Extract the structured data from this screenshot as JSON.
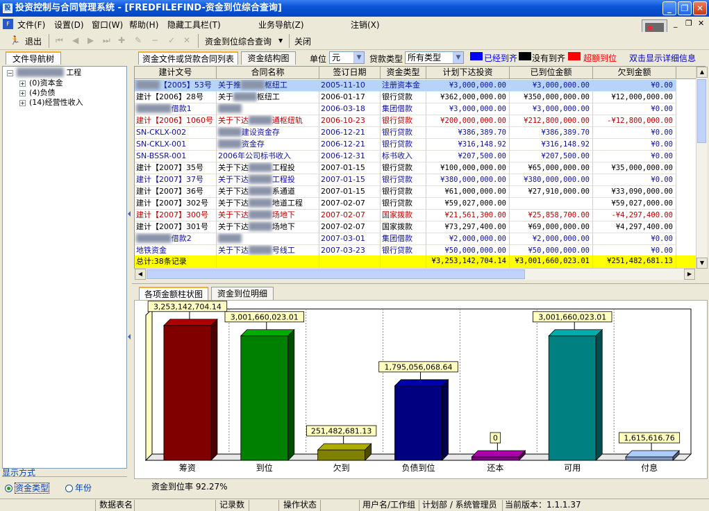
{
  "window": {
    "title": "投资控制与合同管理系统 - [FREDFILEFIND-资金到位综合查询]"
  },
  "menu": [
    "文件(F)",
    "设置(D)",
    "窗口(W)",
    "帮助(H)",
    "隐藏工具栏(T)",
    "业务导航(Z)",
    "注销(X)"
  ],
  "toolbar": {
    "exit_label": "退出",
    "dropdown_label": "资金到位综合查询",
    "close_label": "关闭"
  },
  "left_panel": {
    "tab": "文件导航树",
    "tree": [
      "工程",
      "(0)资本金",
      "(4)负债",
      "(14)经营性收入"
    ],
    "display_mode_label": "显示方式",
    "options": [
      "资金类型",
      "年份"
    ],
    "selected": "资金类型"
  },
  "filter": {
    "tabs": [
      "资金文件或贷款合同列表",
      "资金结构图"
    ],
    "unit_label": "单位",
    "unit_value": "元",
    "loan_type_label": "贷款类型",
    "loan_type_value": "所有类型",
    "legend": [
      {
        "label": "已经到齐",
        "color": "#0000ff"
      },
      {
        "label": "没有到齐",
        "color": "#000000"
      },
      {
        "label": "超额到位",
        "color": "#ff0000"
      }
    ],
    "hint": "双击显示详细信息"
  },
  "table": {
    "columns": [
      "建计文号",
      "合同名称",
      "签订日期",
      "资金类型",
      "计划下达投资",
      "已到位金额",
      "欠到金额"
    ],
    "rows": [
      {
        "doc": "【2005】53号",
        "name": "关于推",
        "name2": "枢纽工",
        "date": "2005-11-10",
        "type": "注册资本金",
        "plan": "¥3,000,000.00",
        "arrived": "¥3,000,000.00",
        "owed": "¥0.00",
        "color": "blue"
      },
      {
        "doc": "建计【2006】28号",
        "name": "关于",
        "name2": "枢纽工",
        "date": "2006-01-17",
        "type": "银行贷款",
        "plan": "¥362,000,000.00",
        "arrived": "¥350,000,000.00",
        "owed": "¥12,000,000.00",
        "color": "black"
      },
      {
        "doc": "借款1",
        "name": "",
        "name2": "",
        "date": "2006-03-18",
        "type": "集团借款",
        "plan": "¥3,000,000.00",
        "arrived": "¥3,000,000.00",
        "owed": "¥0.00",
        "color": "blue"
      },
      {
        "doc": "建计【2006】1060号",
        "name": "关于下达",
        "name2": "通枢纽轨",
        "date": "2006-10-23",
        "type": "银行贷款",
        "plan": "¥200,000,000.00",
        "arrived": "¥212,800,000.00",
        "owed": "-¥12,800,000.00",
        "color": "red"
      },
      {
        "doc": "SN-CKLX-002",
        "name": "",
        "name2": "建设资金存",
        "date": "2006-12-21",
        "type": "银行贷款",
        "plan": "¥386,389.70",
        "arrived": "¥386,389.70",
        "owed": "¥0.00",
        "color": "blue"
      },
      {
        "doc": "SN-CKLX-001",
        "name": "",
        "name2": "资金存",
        "date": "2006-12-21",
        "type": "银行贷款",
        "plan": "¥316,148.92",
        "arrived": "¥316,148.92",
        "owed": "¥0.00",
        "color": "blue"
      },
      {
        "doc": "SN-BSSR-001",
        "name": "2006年公司标书收入",
        "name2": "",
        "date": "2006-12-31",
        "type": "标书收入",
        "plan": "¥207,500.00",
        "arrived": "¥207,500.00",
        "owed": "¥0.00",
        "color": "blue"
      },
      {
        "doc": "建计【2007】35号",
        "name": "关于下达",
        "name2": "工程投",
        "date": "2007-01-15",
        "type": "银行贷款",
        "plan": "¥100,000,000.00",
        "arrived": "¥65,000,000.00",
        "owed": "¥35,000,000.00",
        "color": "black"
      },
      {
        "doc": "建计【2007】37号",
        "name": "关于下达",
        "name2": "工程投",
        "date": "2007-01-15",
        "type": "银行贷款",
        "plan": "¥380,000,000.00",
        "arrived": "¥380,000,000.00",
        "owed": "¥0.00",
        "color": "blue"
      },
      {
        "doc": "建计【2007】36号",
        "name": "关于下达",
        "name2": "系通道",
        "date": "2007-01-15",
        "type": "银行贷款",
        "plan": "¥61,000,000.00",
        "arrived": "¥27,910,000.00",
        "owed": "¥33,090,000.00",
        "color": "black"
      },
      {
        "doc": "建计【2007】302号",
        "name": "关于下达",
        "name2": "地道工程",
        "date": "2007-02-07",
        "type": "银行贷款",
        "plan": "¥59,027,000.00",
        "arrived": "",
        "owed": "¥59,027,000.00",
        "color": "black"
      },
      {
        "doc": "建计【2007】300号",
        "name": "关于下达",
        "name2": "场地下",
        "date": "2007-02-07",
        "type": "国家拨款",
        "plan": "¥21,561,300.00",
        "arrived": "¥25,858,700.00",
        "owed": "-¥4,297,400.00",
        "color": "red"
      },
      {
        "doc": "建计【2007】301号",
        "name": "关于下达",
        "name2": "场地下",
        "date": "2007-02-07",
        "type": "国家拨款",
        "plan": "¥73,297,400.00",
        "arrived": "¥69,000,000.00",
        "owed": "¥4,297,400.00",
        "color": "black"
      },
      {
        "doc": "借款2",
        "name": "",
        "name2": "",
        "date": "2007-03-01",
        "type": "集团借款",
        "plan": "¥2,000,000.00",
        "arrived": "¥2,000,000.00",
        "owed": "¥0.00",
        "color": "blue"
      },
      {
        "doc": "地铁资金",
        "name": "关于下达",
        "name2": "号线工",
        "date": "2007-03-23",
        "type": "银行贷款",
        "plan": "¥50,000,000.00",
        "arrived": "¥50,000,000.00",
        "owed": "¥0.00",
        "color": "blue"
      }
    ],
    "total": {
      "label": "总计:38条记录",
      "plan": "¥3,253,142,704.14",
      "arrived": "¥3,001,660,023.01",
      "owed": "¥251,482,681.13"
    }
  },
  "chart_tabs": [
    "各项金额柱状图",
    "资金到位明细"
  ],
  "chart_data": {
    "type": "bar",
    "categories": [
      "筹资",
      "到位",
      "欠到",
      "负债到位",
      "还本",
      "可用",
      "付息"
    ],
    "values": [
      3253142704.14,
      3001660023.01,
      251482681.13,
      1795056068.64,
      0,
      3001660023.01,
      1615616.76
    ],
    "value_labels": [
      "3,253,142,704.14",
      "3,001,660,023.01",
      "251,482,681.13",
      "1,795,056,068.64",
      "0",
      "3,001,660,023.01",
      "1,615,616.76"
    ],
    "colors": [
      "#800000",
      "#008000",
      "#808000",
      "#000080",
      "#800080",
      "#008080",
      "#8098c0"
    ],
    "ylim": [
      0,
      3400000000
    ],
    "grid": true
  },
  "chart_footer": "资金到位率 92.27%",
  "statusbar": {
    "db_label": "数据表名",
    "records_label": "记录数",
    "op_label": "操作状态",
    "user_label": "用户名/工作组",
    "user_value": "计划部 / 系统管理员",
    "version": "当前版本：1.1.1.37"
  }
}
